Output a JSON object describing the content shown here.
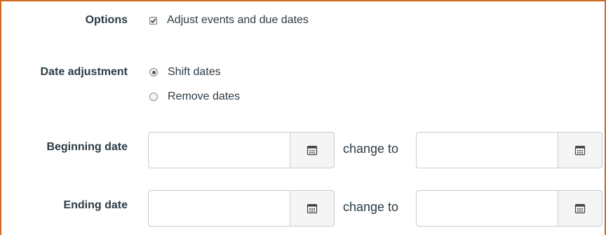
{
  "options": {
    "label": "Options",
    "checkbox_label": "Adjust events and due dates",
    "checked": true
  },
  "date_adjustment": {
    "label": "Date adjustment",
    "choices": [
      {
        "label": "Shift dates",
        "selected": true
      },
      {
        "label": "Remove dates",
        "selected": false
      }
    ]
  },
  "beginning": {
    "label": "Beginning date",
    "change_to": "change to",
    "from_value": "",
    "to_value": ""
  },
  "ending": {
    "label": "Ending date",
    "change_to": "change to",
    "from_value": "",
    "to_value": ""
  },
  "icons": {
    "calendar": "calendar-icon",
    "check": "checkmark-icon"
  },
  "colors": {
    "frame_border": "#d2691e",
    "text": "#2d3b45",
    "input_border": "#c7cdd1"
  }
}
